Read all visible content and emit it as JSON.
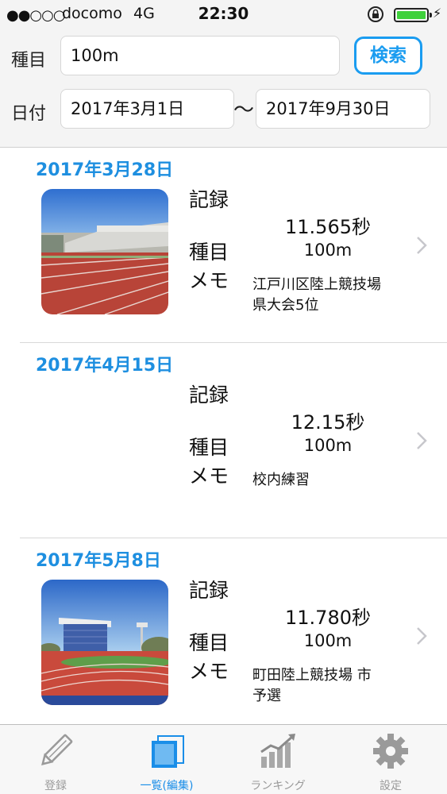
{
  "status_bar": {
    "signal": "●●○○○",
    "carrier": "docomo",
    "network": "4G",
    "time": "22:30",
    "battery_icon": "battery-icon"
  },
  "search": {
    "event_label": "種目",
    "event_value": "100m",
    "search_button": "検索",
    "date_label": "日付",
    "date_from": "2017年3月1日",
    "date_separator": "〜",
    "date_to": "2017年9月30日"
  },
  "field_labels": {
    "record": "記録",
    "event": "種目",
    "memo": "メモ"
  },
  "entries": [
    {
      "date": "2017年3月28日",
      "record": "11.565秒",
      "event": "100m",
      "memo_line1": "江戸川区陸上競技場",
      "memo_line2": "県大会5位",
      "has_photo": true
    },
    {
      "date": "2017年4月15日",
      "record": "12.15秒",
      "event": "100m",
      "memo_line1": "校内練習",
      "memo_line2": "",
      "has_photo": false
    },
    {
      "date": "2017年5月8日",
      "record": "11.780秒",
      "event": "100m",
      "memo_line1": "町田陸上競技場 市",
      "memo_line2": "予選",
      "has_photo": true
    }
  ],
  "tabs": [
    {
      "label": "登録",
      "icon": "pencil-icon",
      "active": false
    },
    {
      "label": "一覧(編集)",
      "icon": "list-icon",
      "active": true
    },
    {
      "label": "ランキング",
      "icon": "chart-icon",
      "active": false
    },
    {
      "label": "設定",
      "icon": "gear-icon",
      "active": false
    }
  ],
  "colors": {
    "accent": "#1a9cf0",
    "date_text": "#1e8fe0",
    "inactive_tab": "#9a9a9a",
    "battery": "#3fd13c"
  }
}
